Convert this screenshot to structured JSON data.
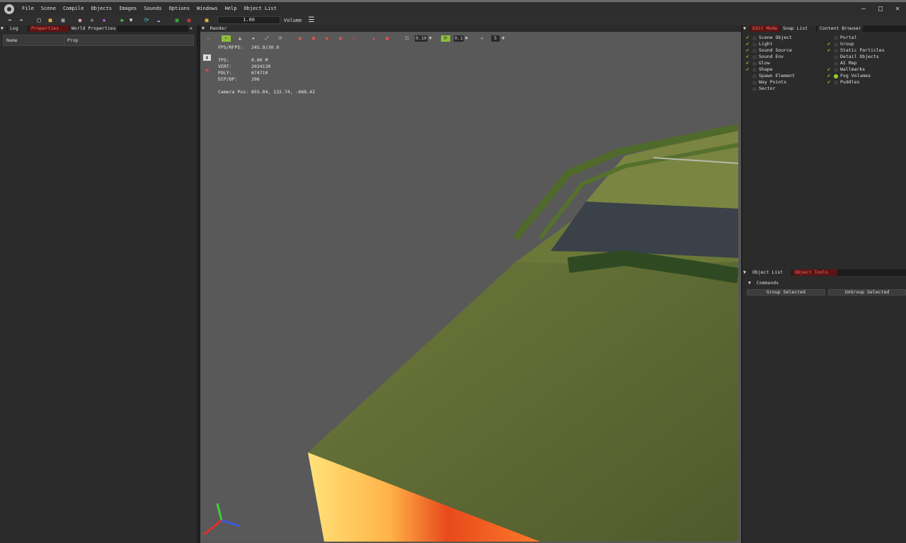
{
  "menubar": {
    "items": [
      "File",
      "Scene",
      "Compile",
      "Objects",
      "Images",
      "Sounds",
      "Options",
      "Windows",
      "Help",
      "Object List"
    ]
  },
  "toolbar": {
    "speed_value": "1.00",
    "volume_label": "Volume"
  },
  "left_panel": {
    "tabs": [
      "Log",
      "Properties",
      "World Properties"
    ],
    "active_tab": "Properties",
    "columns": [
      "Name",
      "Prop"
    ]
  },
  "render": {
    "title": "Render",
    "grid_step": "0.10",
    "rotate_step": "0.1",
    "scale_step": "5",
    "stats": [
      {
        "label": "FPS/RFPS:",
        "value": "245.9/30.0"
      },
      {
        "label": "",
        "value": ""
      },
      {
        "label": "TPS:",
        "value": "0.00 M"
      },
      {
        "label": "VERT:",
        "value": "2024130"
      },
      {
        "label": "POLY:",
        "value": "674710"
      },
      {
        "label": "DIP/DP:",
        "value": "296"
      }
    ],
    "camera_label": "Camera Pos:",
    "camera_value": "855.04, 132.74, -668.42"
  },
  "right_top": {
    "tabs": [
      "Edit Mode",
      "Snap List",
      "Content Browser"
    ],
    "active_tab": "Edit Mode",
    "left_items": [
      {
        "label": "Scene Object",
        "checked": true,
        "dot": false
      },
      {
        "label": "Light",
        "checked": true,
        "dot": false
      },
      {
        "label": "Sound Source",
        "checked": true,
        "dot": false
      },
      {
        "label": "Sound Env",
        "checked": true,
        "dot": false
      },
      {
        "label": "Glow",
        "checked": true,
        "dot": false
      },
      {
        "label": "Shape",
        "checked": true,
        "dot": false
      },
      {
        "label": "Spawn Element",
        "checked": false,
        "dot": false
      },
      {
        "label": "Way Points",
        "checked": false,
        "dot": false
      },
      {
        "label": "Sector",
        "checked": false,
        "dot": false
      }
    ],
    "right_items": [
      {
        "label": "Portal",
        "checked": false,
        "dot": false
      },
      {
        "label": "Group",
        "checked": true,
        "dot": false
      },
      {
        "label": "Static Particles",
        "checked": true,
        "dot": false
      },
      {
        "label": "Detail Objects",
        "checked": false,
        "dot": false
      },
      {
        "label": "AI Map",
        "checked": false,
        "dot": false
      },
      {
        "label": "Wallmarks",
        "checked": true,
        "dot": false
      },
      {
        "label": "Fog Volumes",
        "checked": true,
        "dot": true
      },
      {
        "label": "Puddles",
        "checked": true,
        "dot": false
      }
    ]
  },
  "right_bottom": {
    "tabs": [
      "Object List",
      "Object Tools"
    ],
    "active_tab": "Object Tools",
    "commands_label": "Commands",
    "group_button": "Group Selected",
    "ungroup_button": "UnGroup Selected"
  },
  "colors": {
    "accent_red": "#5a1414",
    "check_green": "#9acd32"
  }
}
